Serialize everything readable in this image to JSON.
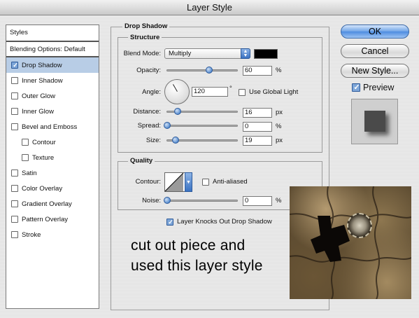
{
  "window": {
    "title": "Layer Style"
  },
  "styles_panel": {
    "header": "Styles",
    "blending": "Blending Options: Default",
    "items": [
      {
        "label": "Drop Shadow",
        "checked": true,
        "selected": true,
        "sub": false
      },
      {
        "label": "Inner Shadow",
        "checked": false,
        "selected": false,
        "sub": false
      },
      {
        "label": "Outer Glow",
        "checked": false,
        "selected": false,
        "sub": false
      },
      {
        "label": "Inner Glow",
        "checked": false,
        "selected": false,
        "sub": false
      },
      {
        "label": "Bevel and Emboss",
        "checked": false,
        "selected": false,
        "sub": false
      },
      {
        "label": "Contour",
        "checked": false,
        "selected": false,
        "sub": true
      },
      {
        "label": "Texture",
        "checked": false,
        "selected": false,
        "sub": true
      },
      {
        "label": "Satin",
        "checked": false,
        "selected": false,
        "sub": false
      },
      {
        "label": "Color Overlay",
        "checked": false,
        "selected": false,
        "sub": false
      },
      {
        "label": "Gradient Overlay",
        "checked": false,
        "selected": false,
        "sub": false
      },
      {
        "label": "Pattern Overlay",
        "checked": false,
        "selected": false,
        "sub": false
      },
      {
        "label": "Stroke",
        "checked": false,
        "selected": false,
        "sub": false
      }
    ]
  },
  "drop_shadow": {
    "title": "Drop Shadow",
    "structure": {
      "title": "Structure",
      "blend_mode_label": "Blend Mode:",
      "blend_mode_value": "Multiply",
      "shadow_color": "#000000",
      "opacity_label": "Opacity:",
      "opacity_value": "60",
      "opacity_unit": "%",
      "opacity_level": 0.6,
      "angle_label": "Angle:",
      "angle_value": "120",
      "angle_unit": "°",
      "global_light_label": "Use Global Light",
      "global_light_checked": false,
      "distance_label": "Distance:",
      "distance_value": "16",
      "distance_unit": "px",
      "spread_label": "Spread:",
      "spread_value": "0",
      "spread_unit": "%",
      "size_label": "Size:",
      "size_value": "19",
      "size_unit": "px"
    },
    "quality": {
      "title": "Quality",
      "contour_label": "Contour:",
      "anti_aliased_label": "Anti-aliased",
      "anti_aliased_checked": false,
      "noise_label": "Noise:",
      "noise_value": "0",
      "noise_unit": "%"
    },
    "knockout_label": "Layer Knocks Out Drop Shadow",
    "knockout_checked": true
  },
  "buttons": {
    "ok": "OK",
    "cancel": "Cancel",
    "new_style": "New Style...",
    "preview_label": "Preview",
    "preview_checked": true
  },
  "overlay": {
    "line1": "cut out piece and",
    "line2": "used this layer style"
  },
  "colors": {
    "accent": "#4d8ce0",
    "selection": "#b8cde6"
  }
}
